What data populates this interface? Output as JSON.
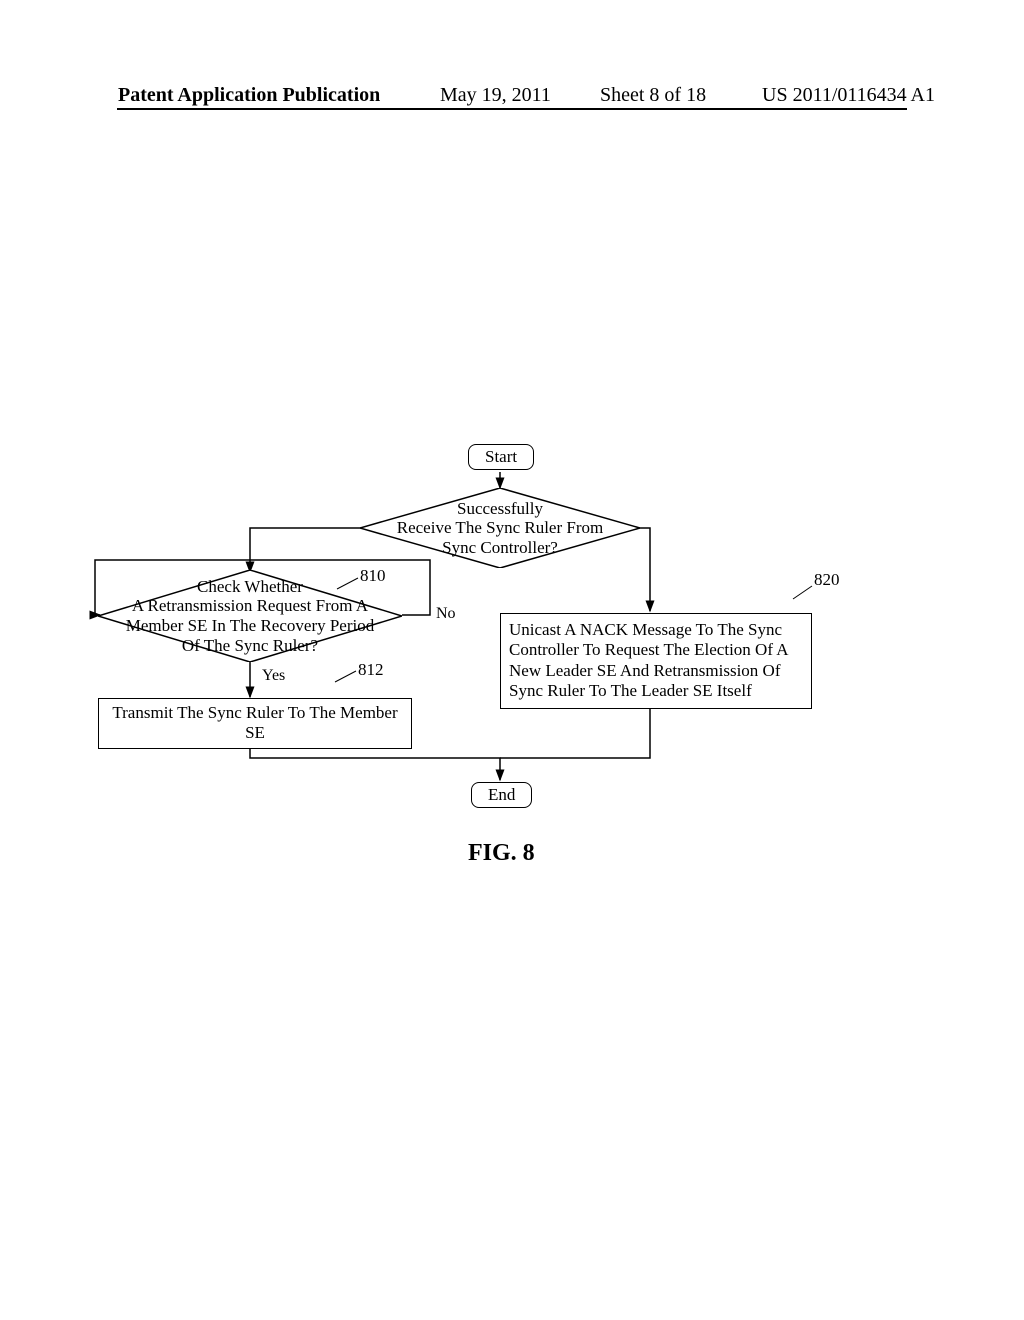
{
  "header": {
    "left": "Patent Application Publication",
    "date": "May 19, 2011",
    "sheet": "Sheet 8 of 18",
    "pubno": "US 2011/0116434 A1"
  },
  "figure_label": "FIG. 8",
  "terminals": {
    "start": "Start",
    "end": "End"
  },
  "decisions": {
    "d1": "Successfully\nReceive The Sync Ruler From\nSync Controller?",
    "d2": "Check Whether\nA Retransmission Request From A\nMember SE In The Recovery Period\nOf The Sync Ruler?"
  },
  "processes": {
    "p812": "Transmit The Sync Ruler To The Member SE",
    "p820": "Unicast A NACK Message To The Sync Controller To Request The Election Of A New Leader SE And Retransmission Of Sync Ruler To The Leader SE Itself"
  },
  "refs": {
    "r810": "810",
    "r812": "812",
    "r820": "820"
  },
  "edge_labels": {
    "d2_no": "No",
    "d2_yes": "Yes"
  },
  "chart_data": {
    "type": "flowchart",
    "nodes": [
      {
        "id": "start",
        "type": "terminal",
        "label": "Start"
      },
      {
        "id": "d1",
        "type": "decision",
        "label": "Successfully Receive The Sync Ruler From Sync Controller?"
      },
      {
        "id": "d2",
        "type": "decision",
        "label": "Check Whether A Retransmission Request From A Member SE In The Recovery Period Of The Sync Ruler?",
        "ref": "810"
      },
      {
        "id": "p812",
        "type": "process",
        "label": "Transmit The Sync Ruler To The Member SE",
        "ref": "812"
      },
      {
        "id": "p820",
        "type": "process",
        "label": "Unicast A NACK Message To The Sync Controller To Request The Election Of A New Leader SE And Retransmission Of Sync Ruler To The Leader SE Itself",
        "ref": "820"
      },
      {
        "id": "end",
        "type": "terminal",
        "label": "End"
      }
    ],
    "edges": [
      {
        "from": "start",
        "to": "d1"
      },
      {
        "from": "d1",
        "to": "d2",
        "label": ""
      },
      {
        "from": "d1",
        "to": "p820",
        "label": ""
      },
      {
        "from": "d2",
        "to": "p812",
        "label": "Yes"
      },
      {
        "from": "d2",
        "to": "d2",
        "label": "No",
        "note": "loop back"
      },
      {
        "from": "p812",
        "to": "end"
      },
      {
        "from": "p820",
        "to": "end"
      }
    ]
  }
}
